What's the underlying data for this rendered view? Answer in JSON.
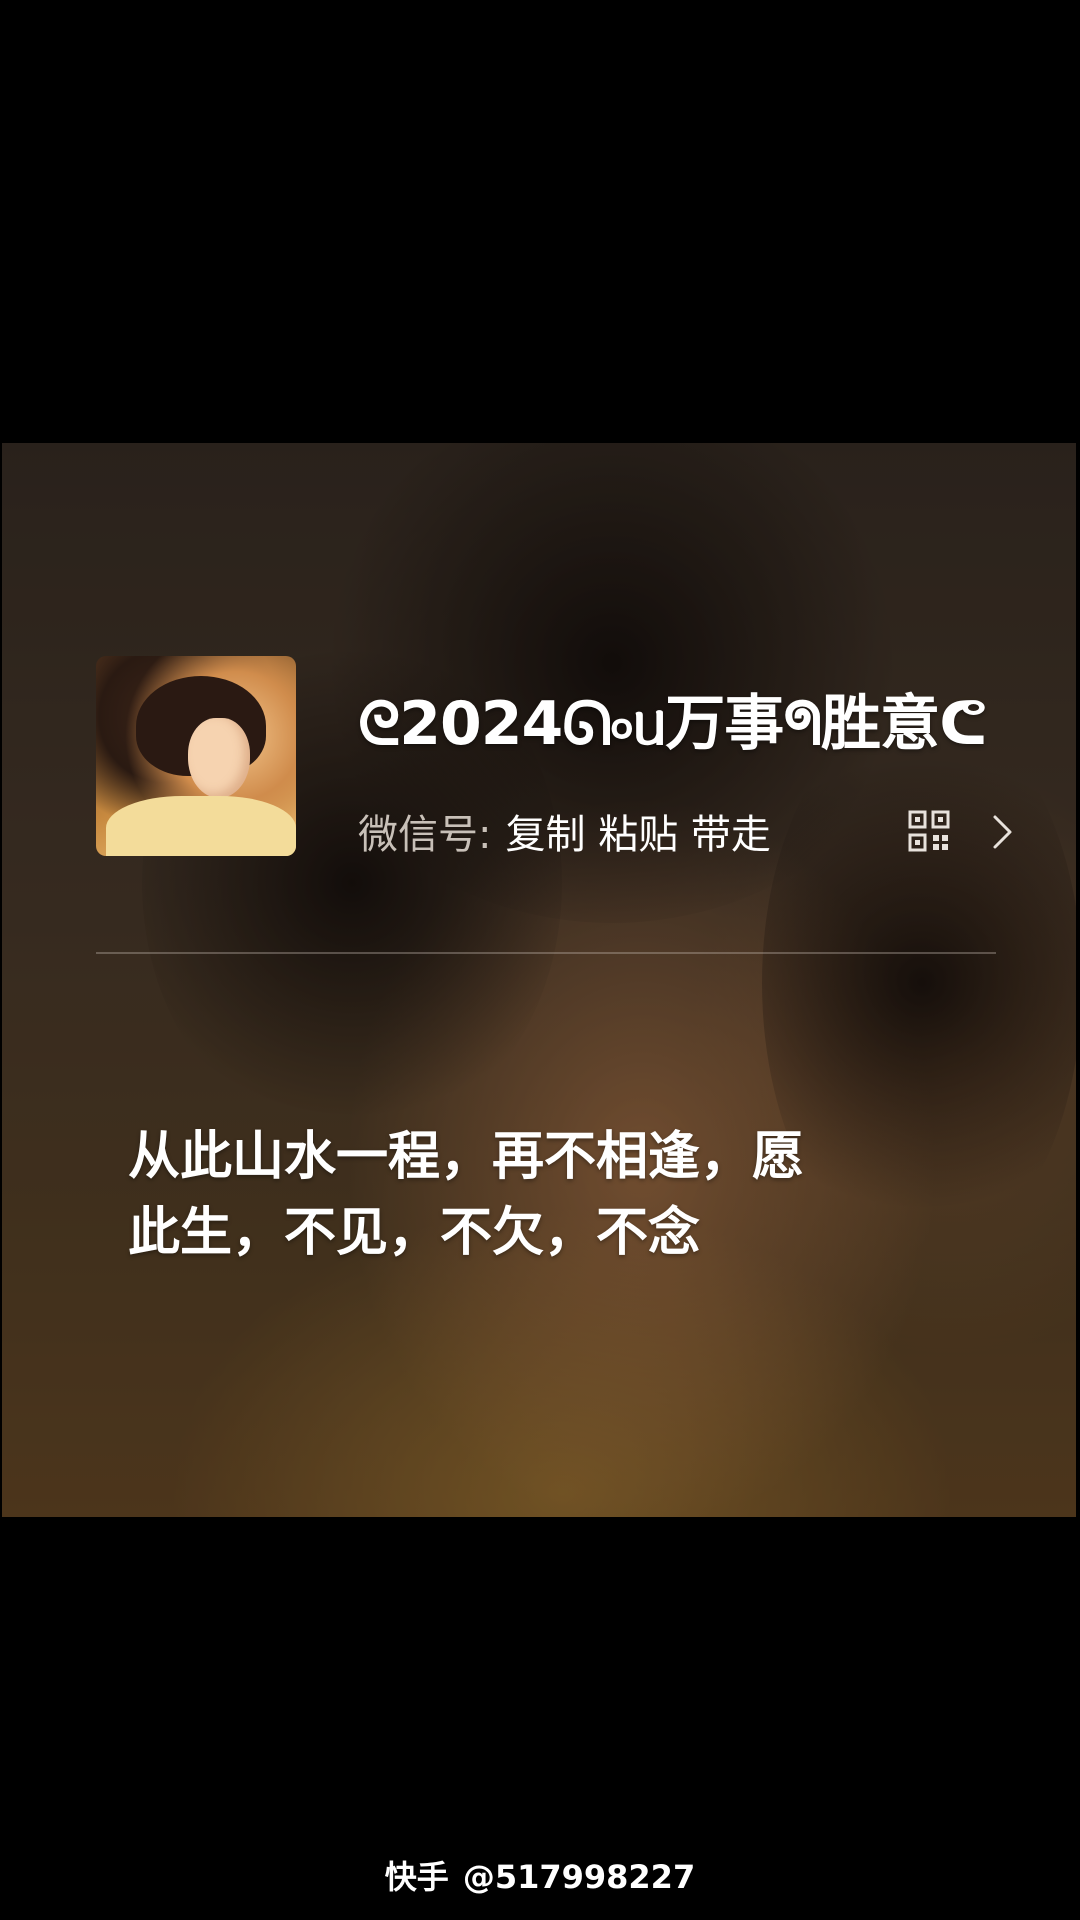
{
  "profile": {
    "nickname": "ᘓ2024ᘏ৹ᥙ万事ᖗ胜意ᕦ",
    "wechat_label": "微信号:",
    "wechat_value": "复制 粘贴 带走",
    "qr_icon": "qr-code-icon",
    "chevron_icon": "chevron-right-icon"
  },
  "quote": {
    "line1": "从此山水一程，再不相逢，愿",
    "line2": "此生，不见，不欠，不念"
  },
  "watermark": {
    "brand": "快手",
    "handle": "@517998227"
  },
  "colors": {
    "background": "#000000",
    "text": "#ffffff",
    "muted_text": "#c8c0b8"
  }
}
